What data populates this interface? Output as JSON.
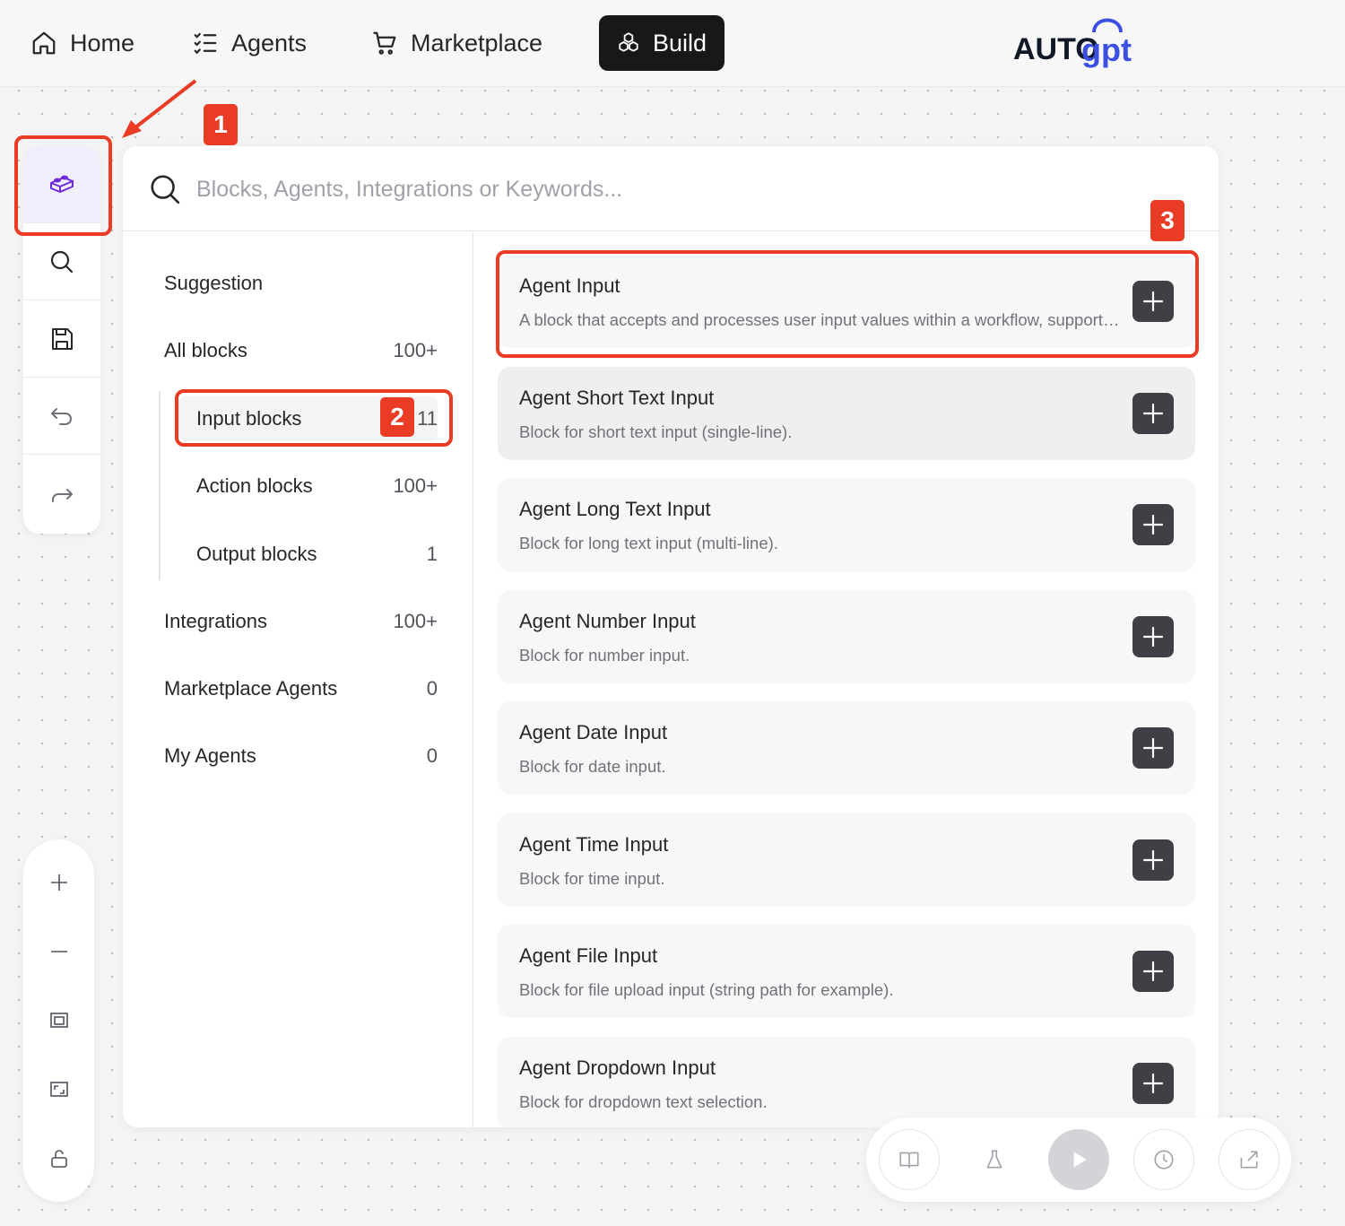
{
  "nav": {
    "home": "Home",
    "agents": "Agents",
    "marketplace": "Marketplace",
    "build": "Build",
    "logo_text_1": "AUTO",
    "logo_text_2": "gpt"
  },
  "search": {
    "placeholder": "Blocks, Agents, Integrations or Keywords..."
  },
  "sidebar": {
    "suggestion": "Suggestion",
    "all_blocks": {
      "label": "All blocks",
      "count": "100+"
    },
    "input_blocks": {
      "label": "Input blocks",
      "count": "11"
    },
    "action_blocks": {
      "label": "Action blocks",
      "count": "100+"
    },
    "output_blocks": {
      "label": "Output blocks",
      "count": "1"
    },
    "integrations": {
      "label": "Integrations",
      "count": "100+"
    },
    "marketplace_agents": {
      "label": "Marketplace Agents",
      "count": "0"
    },
    "my_agents": {
      "label": "My Agents",
      "count": "0"
    }
  },
  "blocks": [
    {
      "title": "Agent Input",
      "desc": "A block that accepts and processes user input values within a workflow, supporting various input types and validation."
    },
    {
      "title": "Agent Short Text Input",
      "desc": "Block for short text input (single-line)."
    },
    {
      "title": "Agent Long Text Input",
      "desc": "Block for long text input (multi-line)."
    },
    {
      "title": "Agent Number Input",
      "desc": "Block for number input."
    },
    {
      "title": "Agent Date Input",
      "desc": "Block for date input."
    },
    {
      "title": "Agent Time Input",
      "desc": "Block for time input."
    },
    {
      "title": "Agent File Input",
      "desc": "Block for file upload input (string path for example)."
    },
    {
      "title": "Agent Dropdown Input",
      "desc": "Block for dropdown text selection."
    }
  ],
  "annotations": {
    "step1": "1",
    "step2": "2",
    "step3": "3"
  },
  "colors": {
    "accent": "#ea3b24",
    "active_nav": "#18181b",
    "add_button": "#3f3f46",
    "active_tool": "#6d28d9"
  },
  "icons": {
    "home": "home-icon",
    "agents": "list-checks-icon",
    "marketplace": "cart-icon",
    "build": "blocks-icon",
    "toolbar": [
      "lego-block-icon",
      "search-icon",
      "save-icon",
      "undo-icon",
      "redo-icon"
    ],
    "zoom": [
      "plus-icon",
      "minus-icon",
      "fit-view-icon",
      "fullscreen-icon",
      "lock-icon"
    ],
    "controls": [
      "book-icon",
      "flask-icon",
      "play-icon",
      "clock-icon",
      "share-icon"
    ]
  }
}
